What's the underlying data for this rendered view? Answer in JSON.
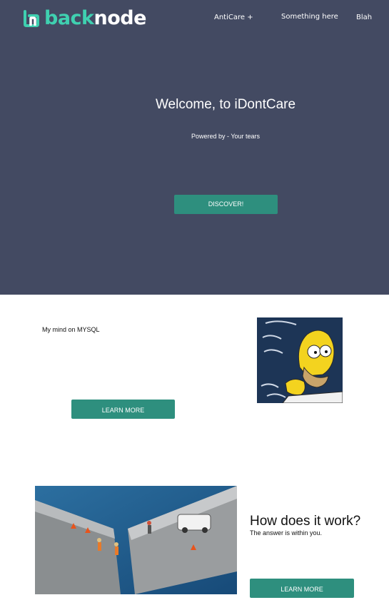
{
  "header": {
    "logo": {
      "part1": "back",
      "part2": "node"
    },
    "nav": [
      {
        "label": "AntiCare +"
      },
      {
        "label": "Something here"
      },
      {
        "label": "Blah"
      }
    ]
  },
  "hero": {
    "title": "Welcome, to iDontCare",
    "subtitle": "Powered by - Your tears",
    "cta": "DISCOVER!"
  },
  "section1": {
    "text": "My mind on MYSQL",
    "button": "LEARN MORE",
    "image": "homer-thinking-image"
  },
  "section2": {
    "title": "How does it work?",
    "subtitle": "The answer is within you.",
    "button": "LEARN MORE",
    "image": "broken-bridge-image"
  },
  "colors": {
    "hero_bg": "#434a62",
    "accent": "#2e8f7e",
    "logo_accent": "#3fd0b0"
  }
}
